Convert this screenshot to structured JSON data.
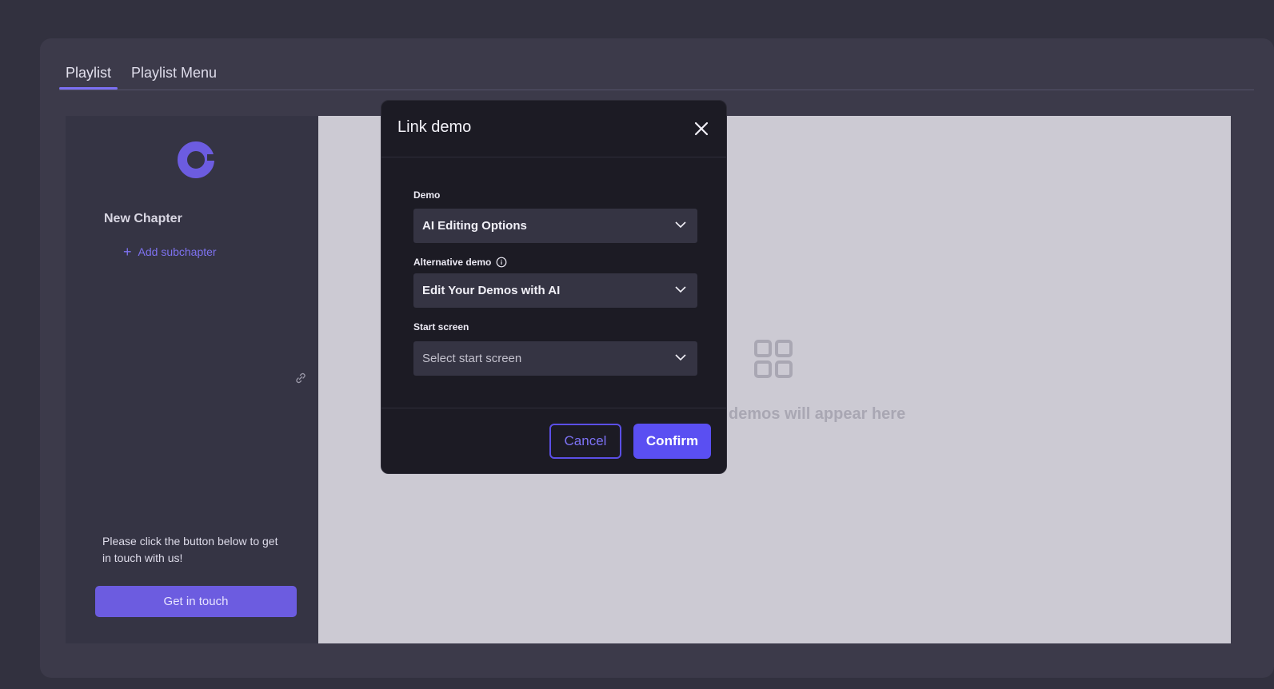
{
  "tabs": [
    {
      "label": "Playlist",
      "active": true
    },
    {
      "label": "Playlist Menu",
      "active": false
    }
  ],
  "sidebar": {
    "logo_icon": "ring-logo-icon",
    "chapter_title": "New Chapter",
    "add_subchapter_label": "Add subchapter",
    "help_text": "Please click the button below to get in touch with us!",
    "get_in_touch_label": "Get in touch"
  },
  "preview": {
    "placeholder_icon": "grid-icon",
    "placeholder_text": "demos will appear here"
  },
  "modal": {
    "title": "Link demo",
    "demo_label": "Demo",
    "demo_value": "AI Editing Options",
    "alt_demo_label": "Alternative demo",
    "alt_demo_value": "Edit Your Demos with AI",
    "start_screen_label": "Start screen",
    "start_screen_placeholder": "Select start screen",
    "cancel_label": "Cancel",
    "confirm_label": "Confirm"
  },
  "colors": {
    "accent": "#5a4ff2",
    "background": "#32313f",
    "modal": "#1c1b24"
  }
}
